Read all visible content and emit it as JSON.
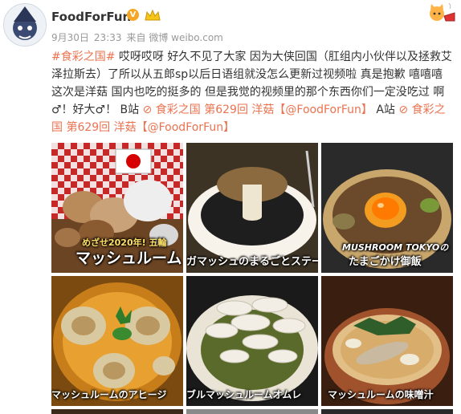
{
  "user": {
    "name": "FoodForFun",
    "verified_badge": "V"
  },
  "meta": {
    "date": "9月30日",
    "time": "23:33",
    "source": "来自 微博 weibo.com"
  },
  "post": {
    "hashtag": "#食彩之国#",
    "text_main": " 哎呀哎呀 好久不见了大家 因为大侠回国（肛组内小伙伴以及拯救艾泽拉斯去）了所以从五郎sp以后日语组就没怎么更新过视频啦 真是抱歉 嘻嘻嘻 这次是洋菇 国内也吃的挺多的 但是我觉的视频里的那个东西你们一定没吃过 啊♂！好大♂！ B站 ",
    "link_b": "食彩之国 第629回 洋菇【@FoodForFun】",
    "text_a": " A站 ",
    "link_a": "食彩之国 第629回 洋菇【@FoodForFun】"
  },
  "thumbnails": [
    {
      "caption": "マッシュルーム",
      "overlay": "めざせ2020年! 五輪"
    },
    {
      "caption": "ガマッシュのまるごとステー"
    },
    {
      "caption": "たまごかけ御飯",
      "overlay": "MUSHROOM TOKYOの"
    },
    {
      "caption": "マッシュルームのアヒージ"
    },
    {
      "caption": "ブルマッシュルームオムレ"
    },
    {
      "caption": "マッシュルームの味噌汁"
    }
  ],
  "colors": {
    "link": "#eb7350",
    "meta": "#999999",
    "badge": "#f5a623"
  },
  "icons": [
    "avatar",
    "verified-badge-icon",
    "crown-icon",
    "cat-emoji-icon",
    "location-icon",
    "link-icon",
    "japan-flag-icon"
  ]
}
